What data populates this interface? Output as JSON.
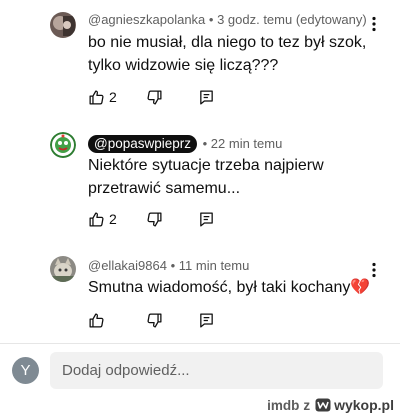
{
  "comments": [
    {
      "author": "@agnieszkapolanka",
      "time": "• 3 godz. temu (edytowany)",
      "text_line1": "bo nie musiał, dla niego to tez był szok,",
      "text_line2": "tylko widzowie się liczą???",
      "likes": "2"
    },
    {
      "author": "@popaswpieprz",
      "time": "• 22 min temu",
      "text_line1": "Niektóre sytuacje trzeba najpierw",
      "text_line2": "przetrawić samemu...",
      "likes": "2"
    },
    {
      "author": "@ellakai9864",
      "time": "• 11 min temu",
      "text_line1": "Smutna wiadomość, był taki kochany💔",
      "likes": ""
    }
  ],
  "reply": {
    "avatar_letter": "Y",
    "placeholder": "Dodaj odpowiedź..."
  },
  "watermark": {
    "user": "imdb",
    "separator": "z",
    "site": "wykop.pl"
  },
  "colors": {
    "text": "#0f0f0f",
    "meta": "#606060",
    "chip_bg": "#0f0f0f",
    "input_bg": "#f1f1f1",
    "avatar_y": "#7f8a93"
  }
}
